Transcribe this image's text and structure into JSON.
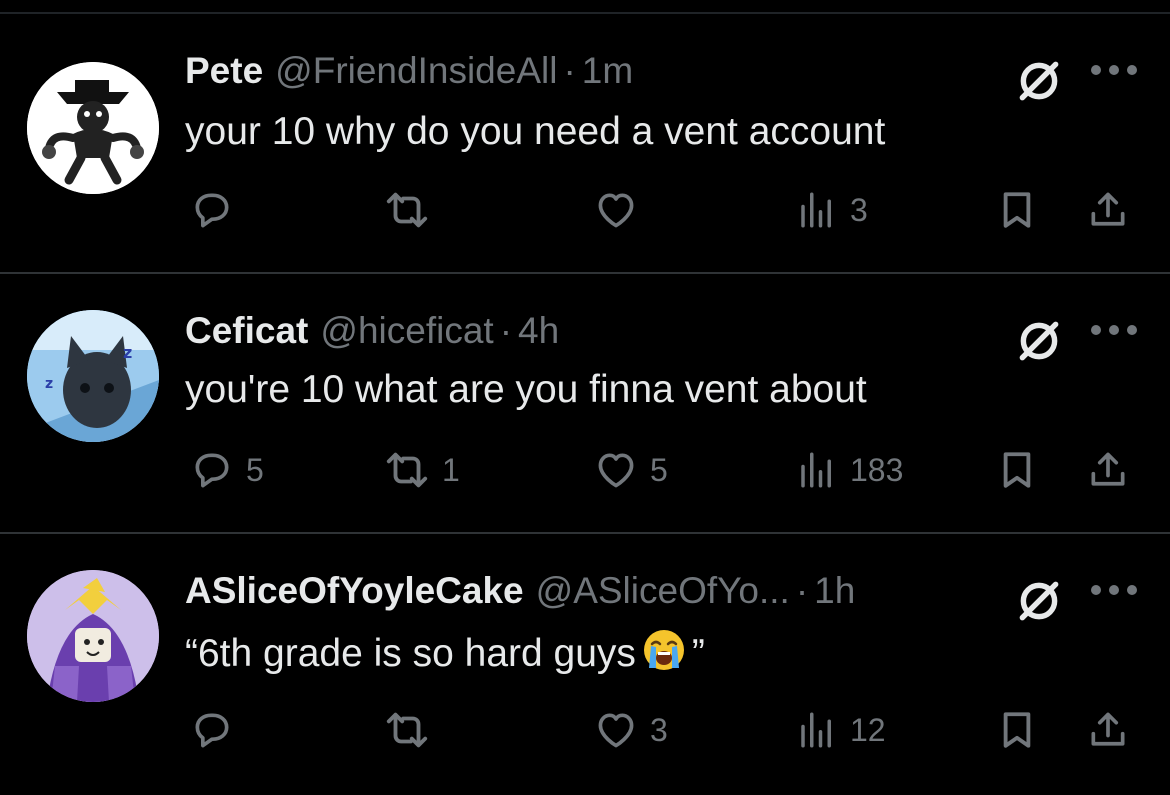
{
  "tweets": [
    {
      "name": "Pete",
      "handle": "@FriendInsideAll",
      "time": "1m",
      "text": "your 10 why do you need a vent account",
      "replies": "",
      "retweets": "",
      "likes": "",
      "views": "3"
    },
    {
      "name": "Ceficat",
      "handle": "@hiceficat",
      "time": "4h",
      "text": "you're 10 what are you finna vent about",
      "replies": "5",
      "retweets": "1",
      "likes": "5",
      "views": "183"
    },
    {
      "name": "ASliceOfYoyleCake",
      "handle": "@ASliceOfYo...",
      "time": "1h",
      "text_before": "“6th grade is so hard guys",
      "text_after": "”",
      "replies": "",
      "retweets": "",
      "likes": "3",
      "views": "12"
    }
  ],
  "separator": "·",
  "colors": {
    "background": "#000000",
    "text": "#e7e9ea",
    "muted": "#71767b",
    "divider": "#2f3336"
  },
  "icons": [
    "reply-icon",
    "retweet-icon",
    "like-icon",
    "views-icon",
    "bookmark-icon",
    "share-icon",
    "mute-icon",
    "more-icon",
    "loudly-crying-face-emoji"
  ]
}
